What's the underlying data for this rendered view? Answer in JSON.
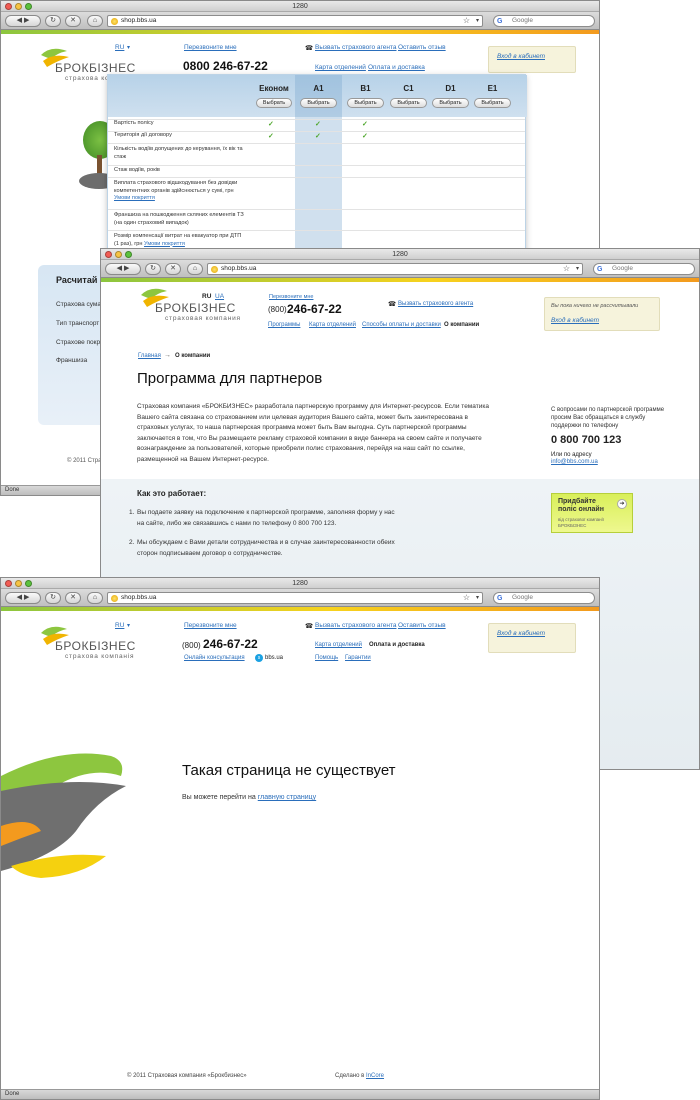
{
  "browser": {
    "title": "1280",
    "url1": "shop.bbs.ua",
    "url2": "shop.bbs.ua",
    "url3": "shop.bbs.ua",
    "search_placeholder": "Google",
    "status": "Done"
  },
  "brand": {
    "name": "БРОКБІЗНЕС",
    "sub_ua": "страхова компанія",
    "sub_ru": "страховая компания",
    "colors": {
      "green": "#8cc63f",
      "yellow": "#f7d21e",
      "orange": "#f39a1e",
      "link": "#2a6ebb"
    }
  },
  "win1": {
    "lang_ru": "RU",
    "lang_arrow": "▾",
    "callback": "Перезвоните мне",
    "phone": "0800 246-67-22",
    "agent": "Вызвать страхового агента",
    "review": "Оставить отзыв",
    "branches": "Карта отделений",
    "payment": "Оплата и доставка",
    "cabinet": "Вход в кабинет",
    "plans": [
      "Економ",
      "A1",
      "B1",
      "C1",
      "D1",
      "E1"
    ],
    "select_label": "Выбрать",
    "rows": [
      {
        "text": "Вартість полісу",
        "checks": [
          true,
          true,
          true,
          false,
          false,
          false
        ]
      },
      {
        "text": "Територія дії договору",
        "checks": [
          true,
          true,
          true,
          false,
          false,
          false
        ]
      },
      {
        "text": "Кількість водіїв допущених до керування, їх вік та стаж",
        "checks": [
          false,
          false,
          false,
          false,
          false,
          false
        ]
      },
      {
        "text": "Стаж водіїв, років",
        "checks": [
          false,
          false,
          false,
          false,
          false,
          false
        ]
      },
      {
        "text": "Виплата страхового відшкодування без довідки компетентних органів здійснюється у сумі, грн",
        "link": "Умови покриття",
        "checks": [
          false,
          false,
          false,
          false,
          false,
          false
        ]
      },
      {
        "text": "Франшиза на пошкодження скляних елементів ТЗ (на один страховий випадок)",
        "checks": [
          false,
          false,
          false,
          false,
          false,
          false
        ]
      },
      {
        "text": "Розмір компенсації витрат на евакуатор при ДТП (1 раз), грн",
        "link": "Умови покриття",
        "checks": [
          false,
          false,
          false,
          false,
          false,
          false
        ]
      }
    ],
    "calc_title": "Расчитай",
    "calc_items": [
      "Страхова сума",
      "Тип транспорт",
      "Страхове покр",
      "Франшиза"
    ],
    "footer": "© 2011 Страх"
  },
  "win2": {
    "lang_ru": "RU",
    "lang_ua": "UA",
    "callback": "Перезвоните мне",
    "phone_code": "(800)",
    "phone": "246-67-22",
    "agent": "Вызвать страхового агента",
    "nav": [
      "Программы",
      "Карта отделений",
      "Способы оплаты и доставки"
    ],
    "nav_active": "О компании",
    "cabinet_note": "Вы пока ничего не рассчитывали",
    "cabinet": "Вход в кабинет",
    "breadcrumb_home": "Главная",
    "breadcrumb_arrow": "→",
    "breadcrumb_current": "О компании",
    "heading": "Программа для партнеров",
    "body": "Страховая компания «БРОКБИЗНЕС» разработала партнерскую программу для Интернет-ресурсов. Если тематика Вашего сайта связана со страхованием или целевая аудитория Вашего сайта, может быть заинтересована в страховых услугах, то наша партнерская программа может быть Вам выгодна. Суть партнерской программы заключается в том, что Вы размещаете рекламу страховой компании в виде баннера на своем сайте и получаете вознаграждение за пользователей, которые приобрели полис страхования, перейдя на наш сайт по ссылке, размещенной на Вашем Интернет-ресурсе.",
    "contact_note": "С вопросами по партнерской программе просим Вас обращаться в службу поддержки по телефону",
    "contact_phone": "0 800 700 123",
    "contact_email_label": "Или по адресу",
    "contact_email": "info@bbs.com.ua",
    "how_title": "Как это работает:",
    "steps": [
      "Вы подаете заявку на подключение к партнерской программе, заполняя форму у нас на сайте, либо же связавшись с нами по телефону 0 800 700 123.",
      "Мы обсуждаем с Вами детали сотрудничества и в случае заинтересованности обеих сторон подписываем договор о сотрудничестве."
    ],
    "banner_title": "Придбайте поліс онлайн",
    "banner_sub": "від страхової компанії БРОКБІЗНЕС"
  },
  "win3": {
    "lang_ru": "RU",
    "lang_arrow": "▾",
    "callback": "Перезвоните мне",
    "phone_code": "(800)",
    "phone": "246-67-22",
    "consult": "Онлайн консультация",
    "skype": "bbs.ua",
    "agent": "Вызвать страхового агента",
    "review": "Оставить отзыв",
    "branches": "Карта отделений",
    "payment": "Оплата и доставка",
    "help": "Помощь",
    "guarantee": "Гарантии",
    "cabinet": "Вход в кабинет",
    "not_found_title": "Такая страница не существует",
    "not_found_text": "Вы можете перейти на",
    "home_link": "главную страницу",
    "copyright": "© 2011 Страховая компания «Брокбизнес»",
    "made_by": "Сделано в",
    "made_by_link": "InCore"
  }
}
